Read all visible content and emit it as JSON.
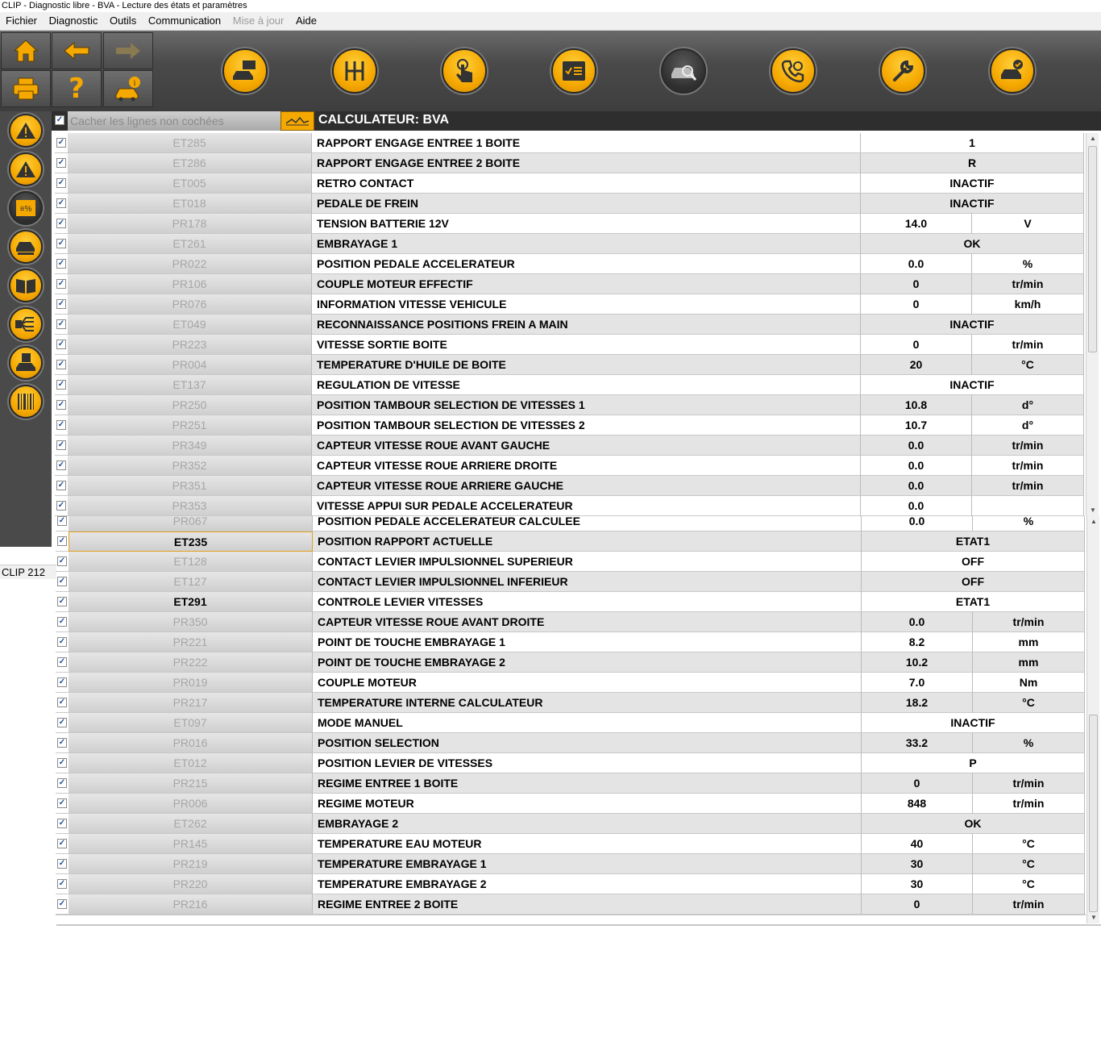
{
  "window_title": "CLIP - Diagnostic libre - BVA - Lecture des états et paramètres",
  "menu": [
    "Fichier",
    "Diagnostic",
    "Outils",
    "Communication",
    "Mise à jour",
    "Aide"
  ],
  "menu_disabled": "Mise à jour",
  "toolbar_icons": [
    "home-icon",
    "back-arrow-icon",
    "forward-arrow-icon",
    "print-icon",
    "help-icon",
    "vehicle-info-icon"
  ],
  "top_buttons": [
    "vehicle-identification-icon",
    "gearbox-icon",
    "touch-icon",
    "checklist-icon",
    "vehicle-diagnosis-icon",
    "phone-support-icon",
    "wrench-icon",
    "vehicle-validated-icon"
  ],
  "side_buttons": [
    "fault-warning-icon",
    "warning-icon",
    "parameters-icon",
    "vehicle-config-icon",
    "manual-book-icon",
    "wiring-icon",
    "vehicle-save-icon",
    "barcode-icon"
  ],
  "status_label": "CLIP 212",
  "header": {
    "filter_label": "Cacher les lignes non cochées",
    "title": "CALCULATEUR: BVA"
  },
  "accent_color": "#f5a800",
  "table_top": [
    {
      "code": "ET285",
      "label": "RAPPORT ENGAGE ENTREE 1 BOITE",
      "value": "1",
      "unit": ""
    },
    {
      "code": "ET286",
      "label": "RAPPORT ENGAGE ENTREE 2 BOITE",
      "value": "R",
      "unit": ""
    },
    {
      "code": "ET005",
      "label": "RETRO CONTACT",
      "value": "INACTIF",
      "unit": ""
    },
    {
      "code": "ET018",
      "label": "PEDALE DE FREIN",
      "value": "INACTIF",
      "unit": ""
    },
    {
      "code": "PR178",
      "label": "TENSION BATTERIE 12V",
      "value": "14.0",
      "unit": "V"
    },
    {
      "code": "ET261",
      "label": "EMBRAYAGE 1",
      "value": "OK",
      "unit": ""
    },
    {
      "code": "PR022",
      "label": "POSITION PEDALE ACCELERATEUR",
      "value": "0.0",
      "unit": "%"
    },
    {
      "code": "PR106",
      "label": "COUPLE MOTEUR EFFECTIF",
      "value": "0",
      "unit": "tr/min"
    },
    {
      "code": "PR076",
      "label": "INFORMATION VITESSE VEHICULE",
      "value": "0",
      "unit": "km/h"
    },
    {
      "code": "ET049",
      "label": "RECONNAISSANCE POSITIONS FREIN A MAIN",
      "value": "INACTIF",
      "unit": ""
    },
    {
      "code": "PR223",
      "label": "VITESSE SORTIE BOITE",
      "value": "0",
      "unit": "tr/min"
    },
    {
      "code": "PR004",
      "label": "TEMPERATURE D'HUILE DE BOITE",
      "value": "20",
      "unit": "°C"
    },
    {
      "code": "ET137",
      "label": "REGULATION DE VITESSE",
      "value": "INACTIF",
      "unit": ""
    },
    {
      "code": "PR250",
      "label": "POSITION TAMBOUR SELECTION DE VITESSES 1",
      "value": "10.8",
      "unit": "d°"
    },
    {
      "code": "PR251",
      "label": "POSITION TAMBOUR SELECTION DE VITESSES 2",
      "value": "10.7",
      "unit": "d°"
    },
    {
      "code": "PR349",
      "label": "CAPTEUR VITESSE ROUE AVANT GAUCHE",
      "value": "0.0",
      "unit": "tr/min"
    },
    {
      "code": "PR352",
      "label": "CAPTEUR VITESSE ROUE ARRIERE DROITE",
      "value": "0.0",
      "unit": "tr/min"
    },
    {
      "code": "PR351",
      "label": "CAPTEUR VITESSE ROUE ARRIERE GAUCHE",
      "value": "0.0",
      "unit": "tr/min"
    },
    {
      "code": "PR353",
      "label": "VITESSE APPUI SUR PEDALE ACCELERATEUR",
      "value": "0.0",
      "unit": ""
    }
  ],
  "table_bottom": [
    {
      "code": "PR067",
      "label": "POSITION PEDALE ACCELERATEUR CALCULEE",
      "value": "0.0",
      "unit": "%"
    },
    {
      "code": "ET235",
      "label": "POSITION RAPPORT ACTUELLE",
      "value": "ETAT1",
      "unit": "",
      "active": true
    },
    {
      "code": "ET128",
      "label": "CONTACT LEVIER IMPULSIONNEL SUPERIEUR",
      "value": "OFF",
      "unit": ""
    },
    {
      "code": "ET127",
      "label": "CONTACT LEVIER IMPULSIONNEL INFERIEUR",
      "value": "OFF",
      "unit": ""
    },
    {
      "code": "ET291",
      "label": "CONTROLE LEVIER VITESSES",
      "value": "ETAT1",
      "unit": "",
      "active": true
    },
    {
      "code": "PR350",
      "label": "CAPTEUR VITESSE ROUE AVANT DROITE",
      "value": "0.0",
      "unit": "tr/min"
    },
    {
      "code": "PR221",
      "label": "POINT DE TOUCHE EMBRAYAGE 1",
      "value": "8.2",
      "unit": "mm"
    },
    {
      "code": "PR222",
      "label": "POINT DE TOUCHE EMBRAYAGE 2",
      "value": "10.2",
      "unit": "mm"
    },
    {
      "code": "PR019",
      "label": "COUPLE MOTEUR",
      "value": "7.0",
      "unit": "Nm"
    },
    {
      "code": "PR217",
      "label": "TEMPERATURE INTERNE CALCULATEUR",
      "value": "18.2",
      "unit": "°C"
    },
    {
      "code": "ET097",
      "label": "MODE MANUEL",
      "value": "INACTIF",
      "unit": ""
    },
    {
      "code": "PR016",
      "label": "POSITION SELECTION",
      "value": "33.2",
      "unit": "%"
    },
    {
      "code": "ET012",
      "label": "POSITION LEVIER DE VITESSES",
      "value": "P",
      "unit": ""
    },
    {
      "code": "PR215",
      "label": "REGIME ENTREE 1 BOITE",
      "value": "0",
      "unit": "tr/min"
    },
    {
      "code": "PR006",
      "label": "REGIME MOTEUR",
      "value": "848",
      "unit": "tr/min"
    },
    {
      "code": "ET262",
      "label": "EMBRAYAGE 2",
      "value": "OK",
      "unit": ""
    },
    {
      "code": "PR145",
      "label": "TEMPERATURE EAU MOTEUR",
      "value": "40",
      "unit": "°C"
    },
    {
      "code": "PR219",
      "label": "TEMPERATURE EMBRAYAGE 1",
      "value": "30",
      "unit": "°C"
    },
    {
      "code": "PR220",
      "label": "TEMPERATURE EMBRAYAGE 2",
      "value": "30",
      "unit": "°C"
    },
    {
      "code": "PR216",
      "label": "REGIME ENTREE 2 BOITE",
      "value": "0",
      "unit": "tr/min"
    }
  ]
}
